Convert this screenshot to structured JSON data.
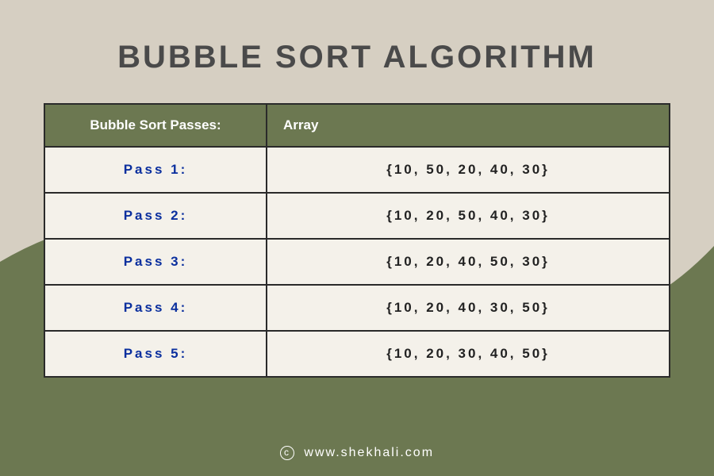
{
  "title": "BUBBLE SORT ALGORITHM",
  "header": {
    "passes": "Bubble Sort Passes:",
    "array": "Array"
  },
  "rows": [
    {
      "pass": "Pass 1:",
      "array": "{10, 50, 20, 40, 30}"
    },
    {
      "pass": "Pass 2:",
      "array": "{10, 20, 50, 40, 30}"
    },
    {
      "pass": "Pass 3:",
      "array": "{10, 20, 40, 50, 30}"
    },
    {
      "pass": "Pass 4:",
      "array": "{10, 20, 40, 30, 50}"
    },
    {
      "pass": "Pass 5:",
      "array": "{10, 20, 30, 40, 50}"
    }
  ],
  "footer": {
    "copyright_symbol": "c",
    "site": "www.shekhali.com"
  },
  "colors": {
    "bg_top": "#d6cfc2",
    "bg_bottom": "#6c7851",
    "header_bg": "#6c7851",
    "pass_text": "#0a2f9e",
    "title_text": "#4a4a4a"
  }
}
